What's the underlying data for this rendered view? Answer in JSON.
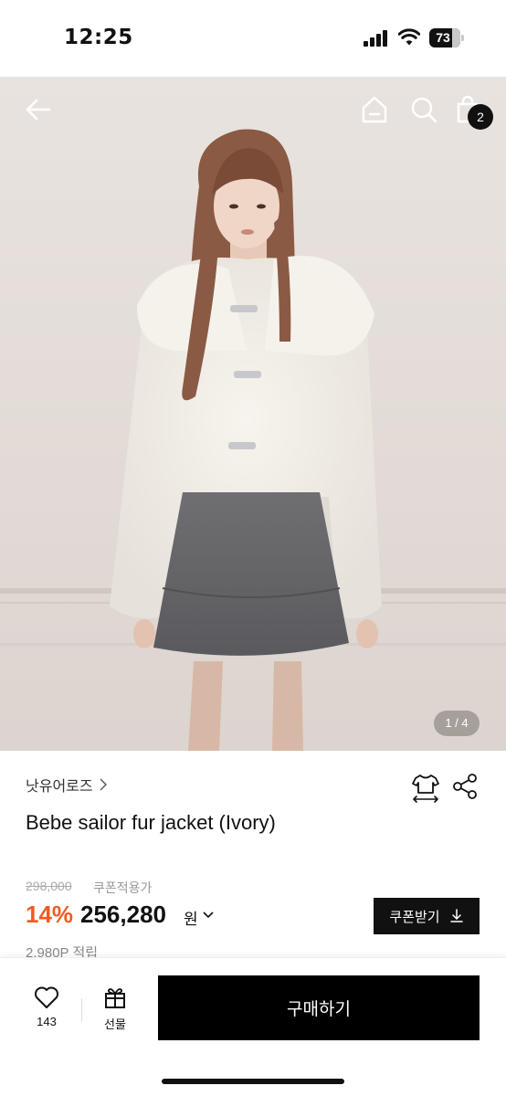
{
  "status_bar": {
    "time": "12:25",
    "battery_level": "73"
  },
  "hero": {
    "page_indicator": "1 / 4",
    "cart_count": "2",
    "icons": [
      "back-arrow-icon",
      "home-icon",
      "search-icon",
      "shopping-bag-icon"
    ]
  },
  "product": {
    "brand": "낫유어로즈",
    "title": "Bebe sailor fur jacket (Ivory)",
    "original_price": "298,000",
    "coupon_note": "쿠폰적용가",
    "discount_rate": "14%",
    "sale_price": "256,280",
    "currency_unit": "원",
    "coupon_button_label": "쿠폰받기",
    "points": "2,980P 적립"
  },
  "bottom_bar": {
    "like_count": "143",
    "gift_label": "선물",
    "buy_label": "구매하기"
  },
  "colors": {
    "accent_discount": "#f05a22",
    "primary_button": "#000000"
  }
}
